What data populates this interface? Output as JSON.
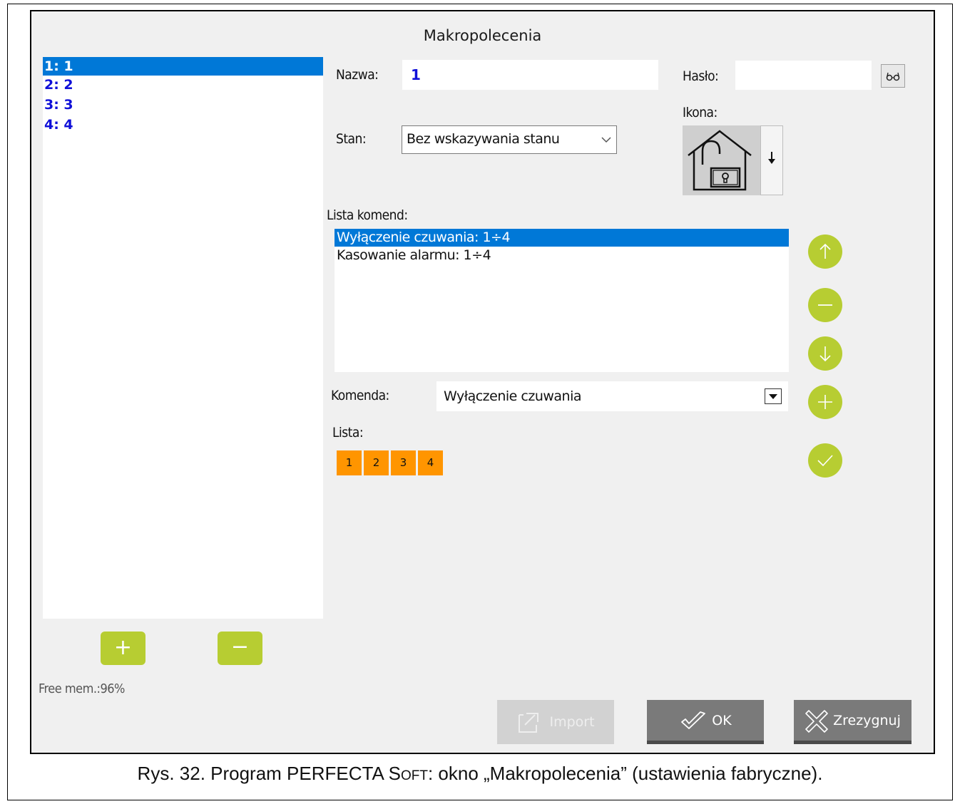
{
  "window": {
    "title": "Makropolecenia"
  },
  "macros": {
    "items": [
      {
        "label": "1: 1"
      },
      {
        "label": "2: 2"
      },
      {
        "label": "3: 3"
      },
      {
        "label": "4: 4"
      }
    ],
    "add_label": "+",
    "remove_label": "−",
    "free_mem": "Free mem.:96%"
  },
  "name": {
    "label": "Nazwa:",
    "value": "1"
  },
  "password": {
    "label": "Hasło:",
    "value": ""
  },
  "icon": {
    "label": "Ikona:",
    "name": "house-unlocked-icon"
  },
  "state": {
    "label": "Stan:",
    "value": "Bez wskazywania stanu"
  },
  "command_list": {
    "label": "Lista komend:",
    "items": [
      {
        "label": "Wyłączenie czuwania: 1÷4"
      },
      {
        "label": "Kasowanie alarmu: 1÷4"
      }
    ]
  },
  "command": {
    "label": "Komenda:",
    "value": "Wyłączenie czuwania"
  },
  "lista": {
    "label": "Lista:",
    "items": [
      "1",
      "2",
      "3",
      "4"
    ]
  },
  "side_buttons": [
    "arrow-up-icon",
    "minus-icon",
    "arrow-down-icon",
    "plus-icon",
    "check-icon"
  ],
  "buttons": {
    "import": "Import",
    "ok": "OK",
    "cancel": "Zrezygnuj"
  },
  "caption": {
    "prefix": "Rys. 32. Program PERFECTA S",
    "small_caps": "OFT",
    "suffix": ": okno „Makropolecenia” (ustawienia fabryczne)."
  },
  "colors": {
    "accent_green": "#b7cd32",
    "selection_blue": "#0078d7",
    "orange": "#ff9500",
    "dark_button": "#7a7a7a"
  }
}
